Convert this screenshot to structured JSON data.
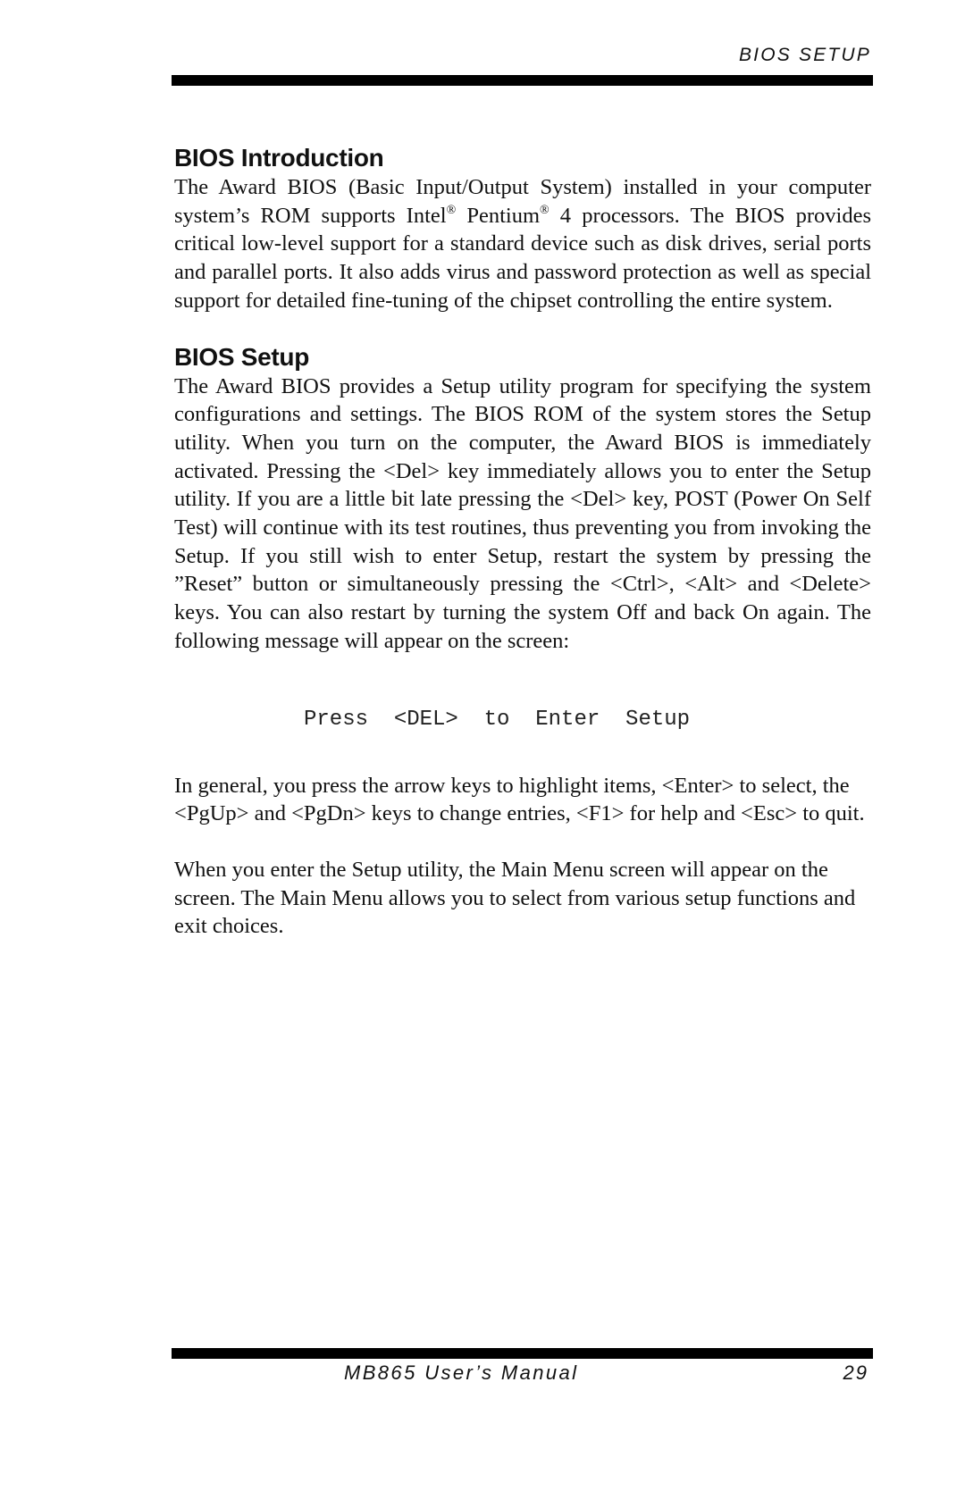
{
  "header": {
    "running_title": "BIOS SETUP"
  },
  "sections": [
    {
      "heading": "BIOS Introduction",
      "paragraph_parts": [
        "The Award BIOS (Basic Input/Output System) installed in your computer system’s ROM supports Intel",
        "®",
        " Pentium",
        "®",
        " 4 processors. The BIOS provides critical low-level support for a standard device such as disk drives, serial ports and parallel ports. It also adds virus and password protection as well as special support for detailed fine-tuning of the chipset controlling the entire system."
      ]
    },
    {
      "heading": "BIOS Setup",
      "paragraph": "The Award BIOS provides a Setup utility program for specifying the system configurations and settings. The BIOS ROM of the system stores the Setup utility. When you turn on the computer, the Award BIOS is immediately activated. Pressing the <Del> key immediately allows you to enter the Setup utility. If you are a little bit late pressing the <Del> key, POST (Power On Self Test) will continue with its test routines, thus preventing you from invoking the Setup. If you still wish to enter Setup, restart the system by pressing the ”Reset” button or simultaneously pressing the <Ctrl>, <Alt> and <Delete> keys. You can also restart by turning the system Off and back On again. The following message will appear on the screen:",
      "screen_message": "Press  <DEL>  to  Enter  Setup",
      "paragraph_keys": "In general, you press the arrow keys to highlight items, <Enter> to select, the <PgUp> and <PgDn> keys to change entries, <F1> for help and <Esc> to quit.",
      "paragraph_main_menu": "When you enter the Setup utility, the Main Menu screen will appear on the screen. The Main Menu allows you to select from various setup functions and exit choices."
    }
  ],
  "footer": {
    "manual_title": "MB865 User’s Manual",
    "page_number": "29"
  }
}
